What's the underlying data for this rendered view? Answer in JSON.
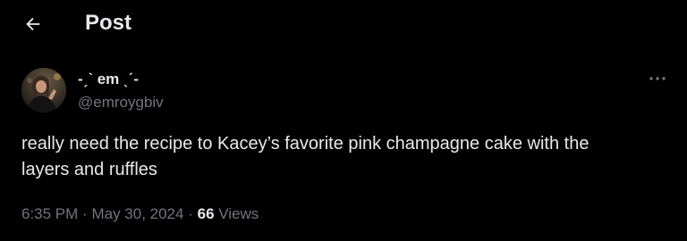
{
  "header": {
    "back_icon": "arrow-left-icon",
    "title": "Post"
  },
  "author": {
    "display_name": "-ˏˋ em ˎˊ-",
    "handle": "@emroygbiv",
    "avatar": "profile-photo"
  },
  "more_icon": "more-horizontal-icon",
  "tweet": {
    "text": "really need the recipe to Kacey’s favorite pink champagne cake with the\nlayers and ruffles"
  },
  "meta": {
    "time": "6:35 PM",
    "separator": "·",
    "date": "May 30, 2024",
    "separator2": "·",
    "views_count": "66",
    "views_label": "Views"
  },
  "colors": {
    "background": "#000000",
    "text": "#e7e9ea",
    "secondary_text": "#71767b"
  }
}
